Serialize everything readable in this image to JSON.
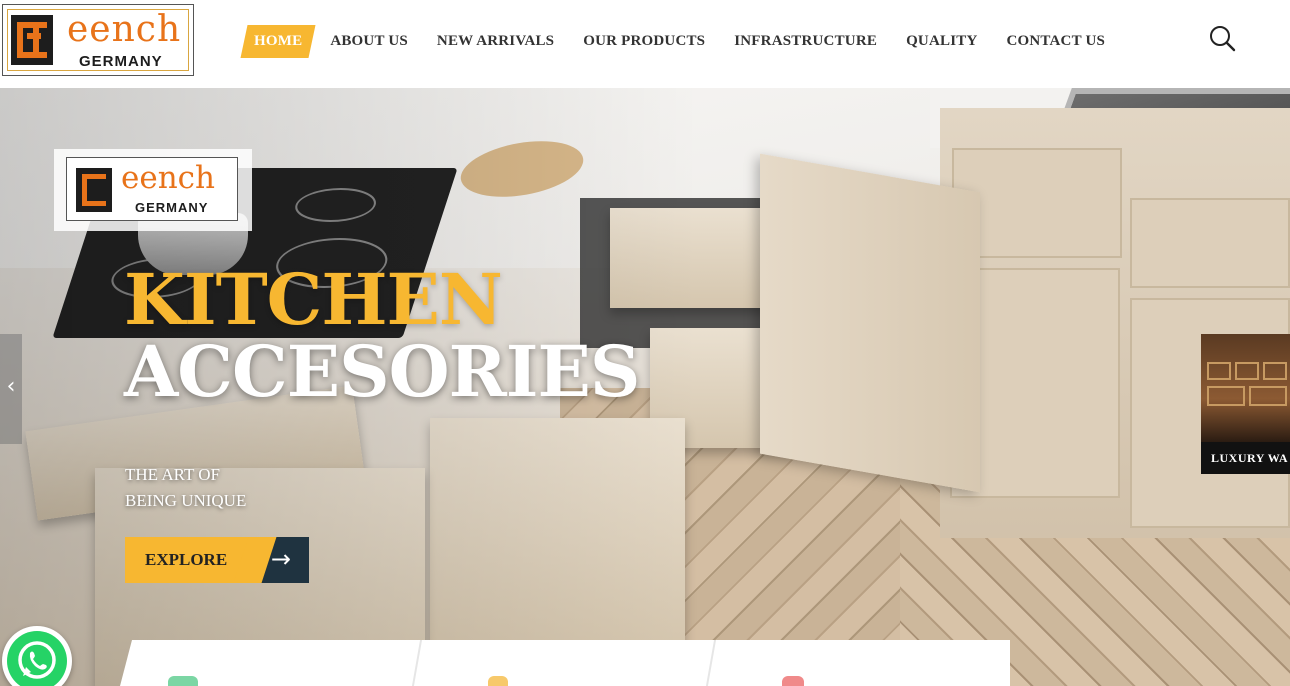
{
  "header": {
    "logo_word": "eench",
    "logo_sub": "GERMANY",
    "nav": [
      {
        "label": "HOME",
        "active": true
      },
      {
        "label": "ABOUT US"
      },
      {
        "label": "NEW ARRIVALS"
      },
      {
        "label": "OUR PRODUCTS"
      },
      {
        "label": "INFRASTRUCTURE"
      },
      {
        "label": "QUALITY"
      },
      {
        "label": "CONTACT US"
      }
    ],
    "search_icon": "search-icon"
  },
  "hero": {
    "logo_word": "eench",
    "logo_sub": "GERMANY",
    "title_line1": "KITCHEN",
    "title_line2": "ACCESORIES",
    "tagline_line1": "THE ART OF",
    "tagline_line2": "BEING UNIQUE",
    "cta_label": "EXPLORE",
    "cta_arrow": "→",
    "prev_arrow": "‹",
    "next_caption": "LUXURY WA"
  },
  "colors": {
    "accent": "#f7b731",
    "brand_orange": "#e8731a",
    "dark_blue": "#1f3340",
    "whatsapp_green": "#25d366"
  }
}
